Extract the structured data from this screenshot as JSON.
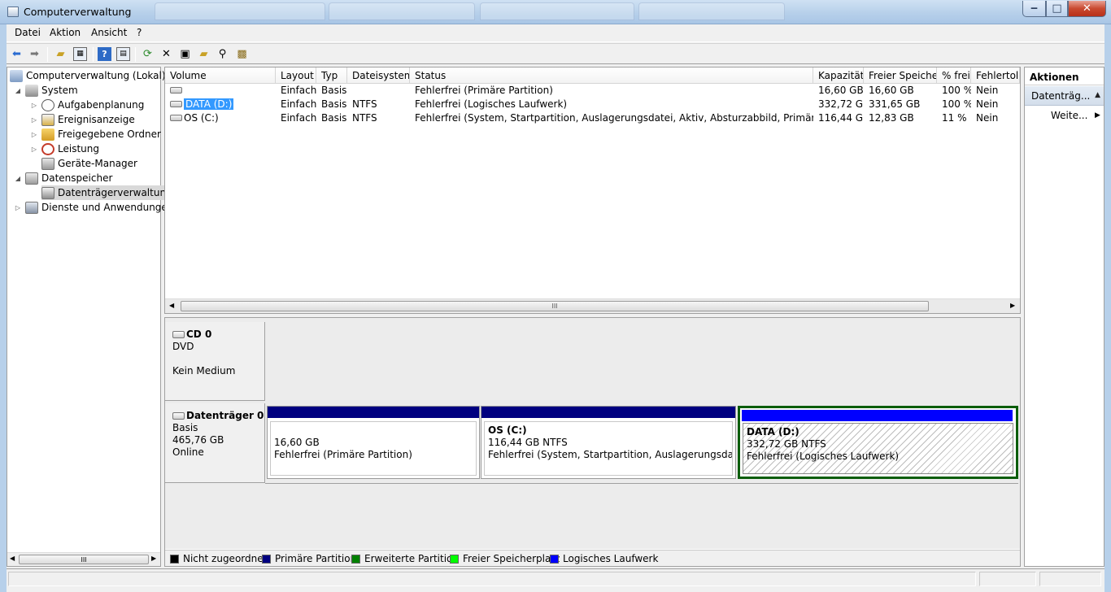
{
  "window": {
    "title": "Computerverwaltung",
    "accent": "#b7d0ea"
  },
  "menu": {
    "items": [
      "Datei",
      "Aktion",
      "Ansicht",
      "?"
    ]
  },
  "toolbar": {
    "icons": [
      "back-icon",
      "forward-icon",
      "up-folder-icon",
      "show-tree-icon",
      "help-icon",
      "properties-pane-icon",
      "refresh-icon",
      "delete-icon",
      "properties-icon",
      "open-icon",
      "search-icon",
      "disk-settings-icon"
    ]
  },
  "tree": {
    "root": "Computerverwaltung (Lokal)",
    "system": "System",
    "aufgabenplanung": "Aufgabenplanung",
    "ereignisanzeige": "Ereignisanzeige",
    "freigegebene": "Freigegebene Ordner",
    "leistung": "Leistung",
    "geraete": "Geräte-Manager",
    "datenspeicher": "Datenspeicher",
    "datentraeger": "Datenträgerverwaltung",
    "dienste": "Dienste und Anwendungen"
  },
  "volumes": {
    "columns": [
      "Volume",
      "Layout",
      "Typ",
      "Dateisystem",
      "Status",
      "Kapazität",
      "Freier Speicher",
      "% frei",
      "Fehlertole"
    ],
    "rows": [
      {
        "volume": "",
        "layout": "Einfach",
        "typ": "Basis",
        "fs": "",
        "status": "Fehlerfrei (Primäre Partition)",
        "cap": "16,60 GB",
        "free": "16,60 GB",
        "pct": "100 %",
        "fault": "Nein"
      },
      {
        "volume": "DATA (D:)",
        "layout": "Einfach",
        "typ": "Basis",
        "fs": "NTFS",
        "status": "Fehlerfrei (Logisches Laufwerk)",
        "cap": "332,72 GB",
        "free": "331,65 GB",
        "pct": "100 %",
        "fault": "Nein"
      },
      {
        "volume": "OS (C:)",
        "layout": "Einfach",
        "typ": "Basis",
        "fs": "NTFS",
        "status": "Fehlerfrei (System, Startpartition, Auslagerungsdatei, Aktiv, Absturzabbild, Primäre Partition)",
        "cap": "116,44 GB",
        "free": "12,83 GB",
        "pct": "11 %",
        "fault": "Nein"
      }
    ],
    "scroll_grip": "III"
  },
  "disks": {
    "cd": {
      "name": "CD 0",
      "type": "DVD",
      "media": "Kein Medium"
    },
    "disk0": {
      "name": "Datenträger 0",
      "type": "Basis",
      "size": "465,76 GB",
      "status": "Online"
    },
    "partitions": [
      {
        "name": "",
        "size": "16,60 GB",
        "status": "Fehlerfrei (Primäre Partition)",
        "color": "#000080"
      },
      {
        "name": "OS  (C:)",
        "size": "116,44 GB NTFS",
        "status": "Fehlerfrei (System, Startpartition, Auslagerungsdatei, Akti",
        "color": "#000080"
      },
      {
        "name": "DATA  (D:)",
        "size": "332,72 GB NTFS",
        "status": "Fehlerfrei (Logisches Laufwerk)",
        "color": "#0000ff"
      }
    ]
  },
  "legend": [
    {
      "label": "Nicht zugeordnet",
      "color": "#000000"
    },
    {
      "label": "Primäre Partition",
      "color": "#000080"
    },
    {
      "label": "Erweiterte Partition",
      "color": "#008000"
    },
    {
      "label": "Freier Speicherplatz",
      "color": "#00ff00"
    },
    {
      "label": "Logisches Laufwerk",
      "color": "#0000ff"
    }
  ],
  "actions": {
    "title": "Aktionen",
    "sub": "Datenträg...",
    "more": "Weite..."
  },
  "tree_scroll": {
    "grip": "III"
  }
}
